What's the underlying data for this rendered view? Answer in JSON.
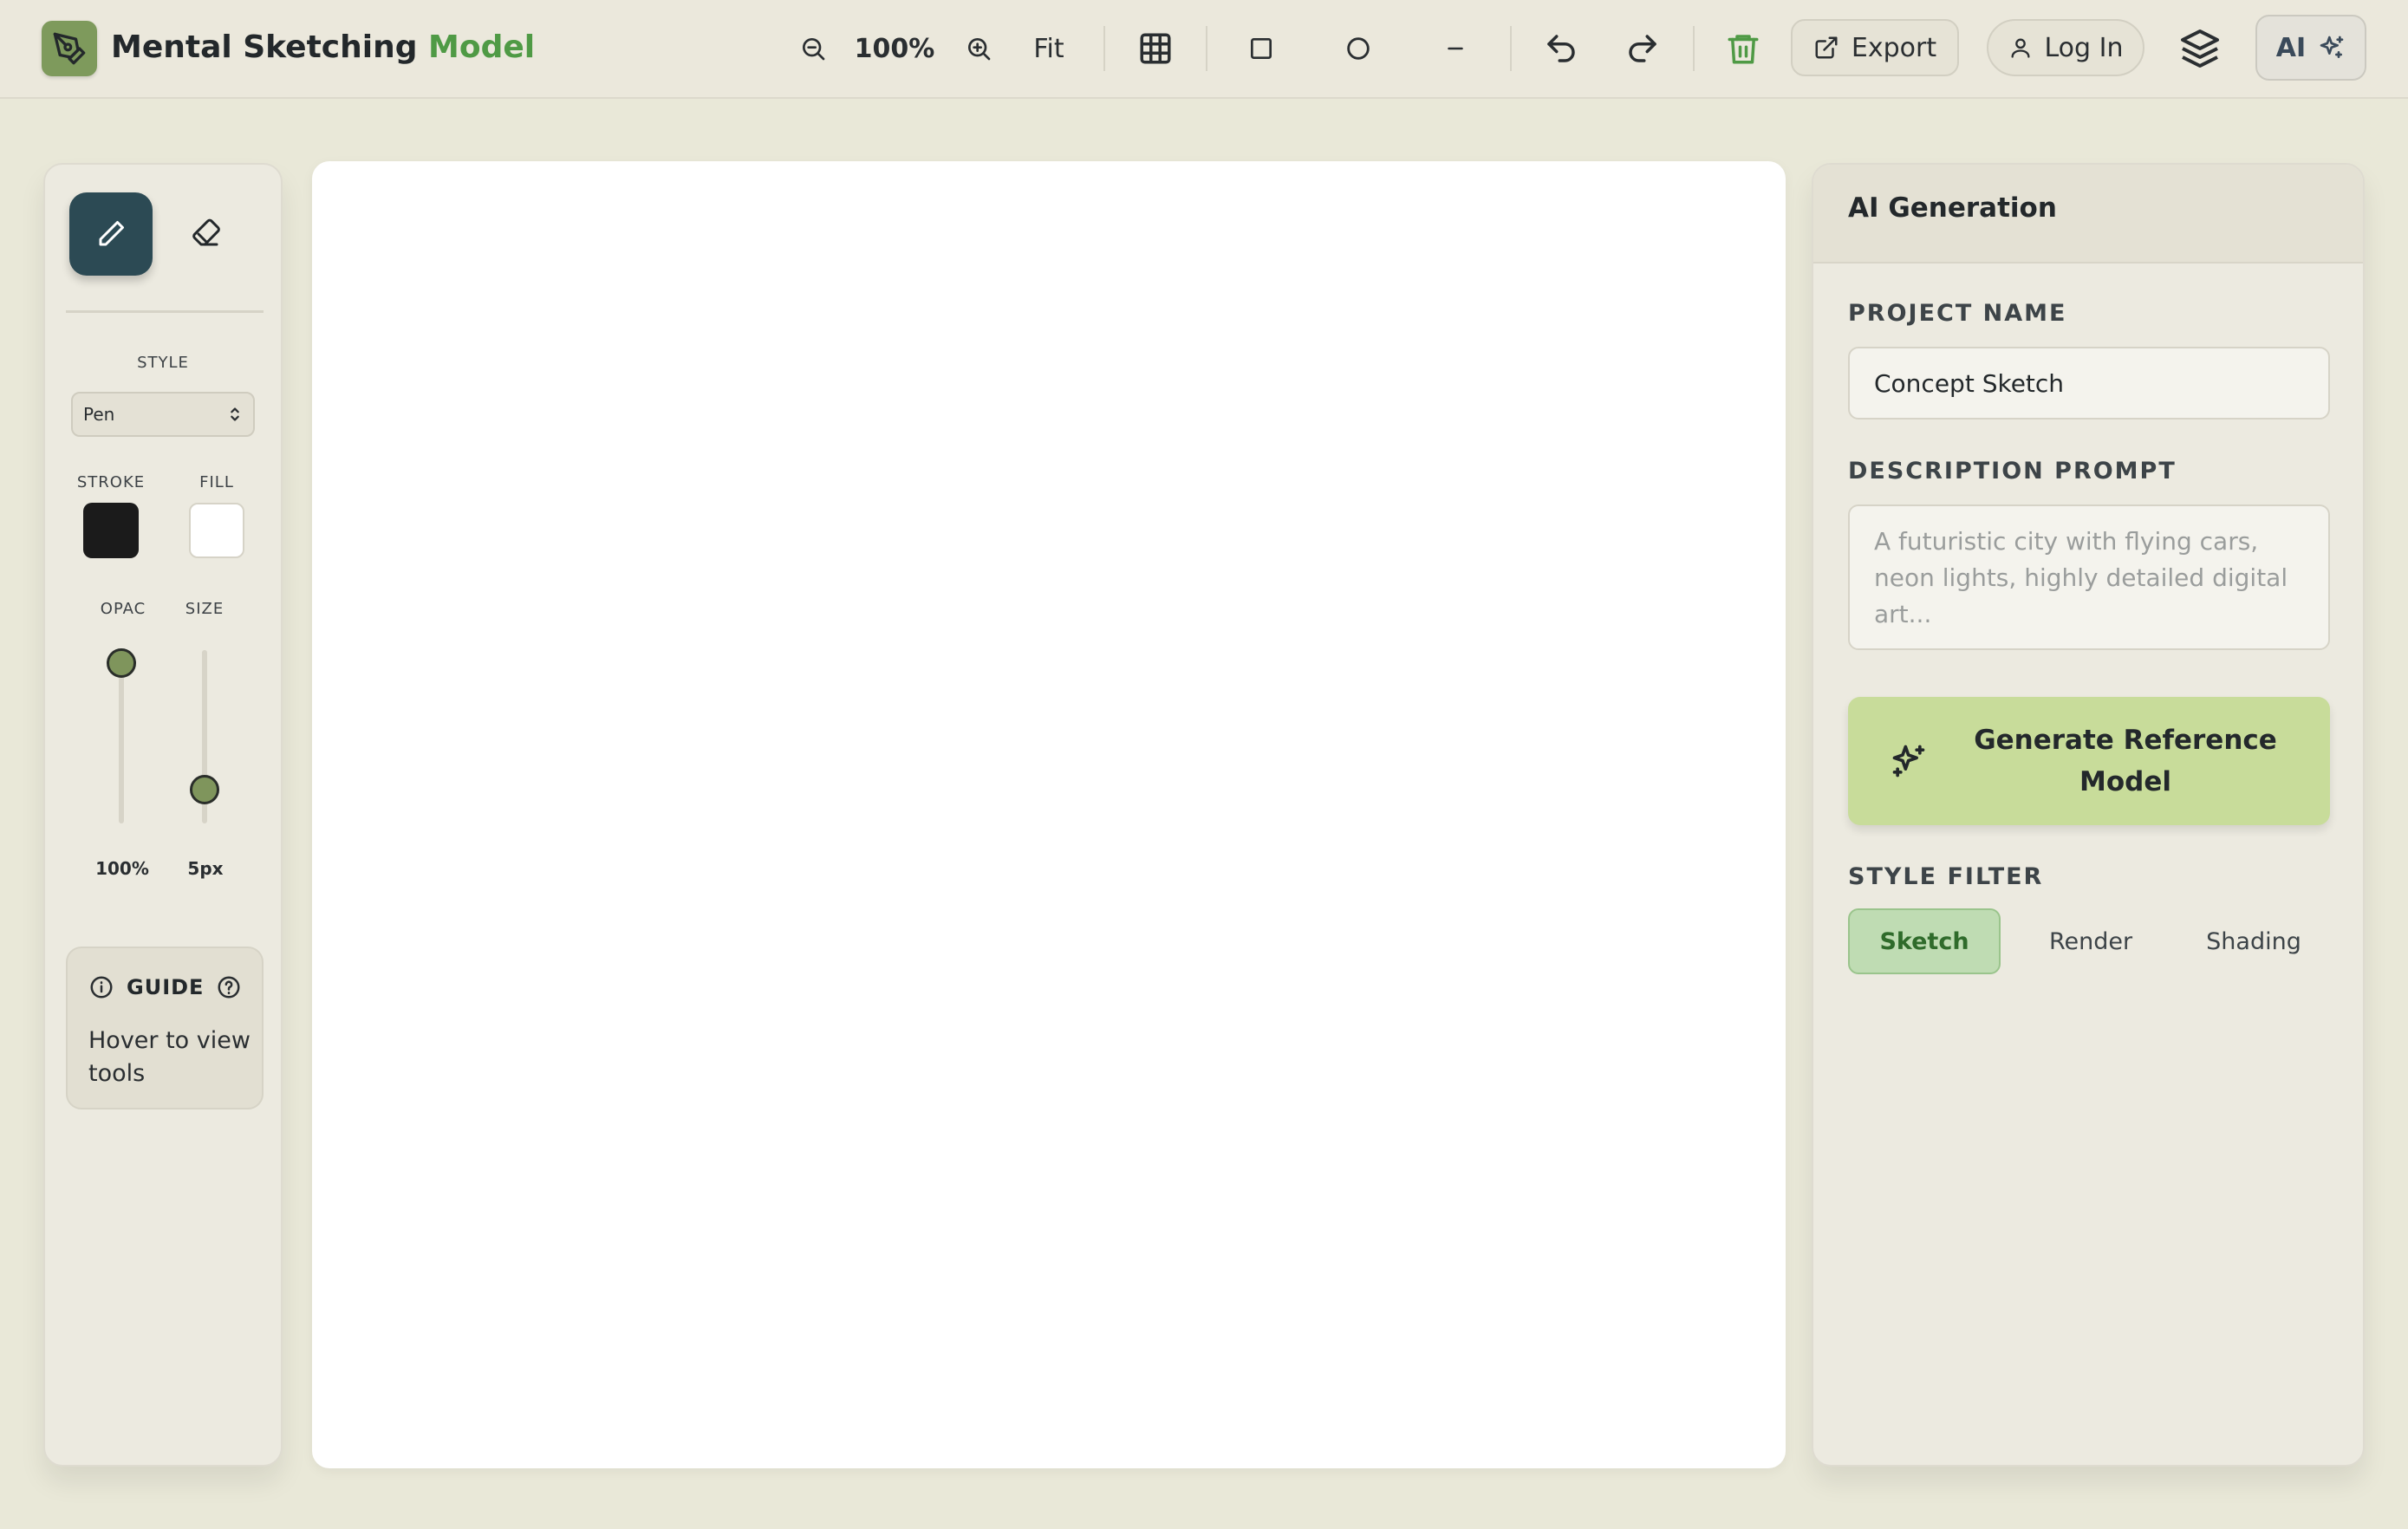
{
  "app": {
    "title_main": "Mental Sketching",
    "title_accent": "Model"
  },
  "toolbar": {
    "zoom_level": "100%",
    "fit_label": "Fit",
    "export_label": "Export",
    "login_label": "Log In",
    "ai_label": "AI"
  },
  "left_panel": {
    "style_label": "STYLE",
    "style_value": "Pen",
    "stroke_label": "STROKE",
    "fill_label": "FILL",
    "stroke_color": "#1b1b1b",
    "fill_color": "#ffffff",
    "opacity_label": "OPAC",
    "size_label": "SIZE",
    "opacity_value": "100%",
    "opacity_level": 1.0,
    "size_value": "5px",
    "size_level": 0.1,
    "guide_title": "GUIDE",
    "guide_text": "Hover to view tools"
  },
  "right_panel": {
    "title": "AI Generation",
    "project_name_label": "PROJECT NAME",
    "project_name_value": "Concept Sketch",
    "description_label": "DESCRIPTION PROMPT",
    "description_placeholder": "A futuristic city with flying cars, neon lights, highly detailed digital art...",
    "generate_label": "Generate Reference Model",
    "style_filter_label": "STYLE FILTER",
    "filters": [
      "Sketch",
      "Render",
      "Shading"
    ],
    "active_filter": "Sketch"
  },
  "colors": {
    "accent_green": "#4f9a45",
    "pen_tool_bg": "#2c4a54",
    "generate_button_bg": "#c8dc9a",
    "active_chip_bg": "#bfdcb3"
  }
}
